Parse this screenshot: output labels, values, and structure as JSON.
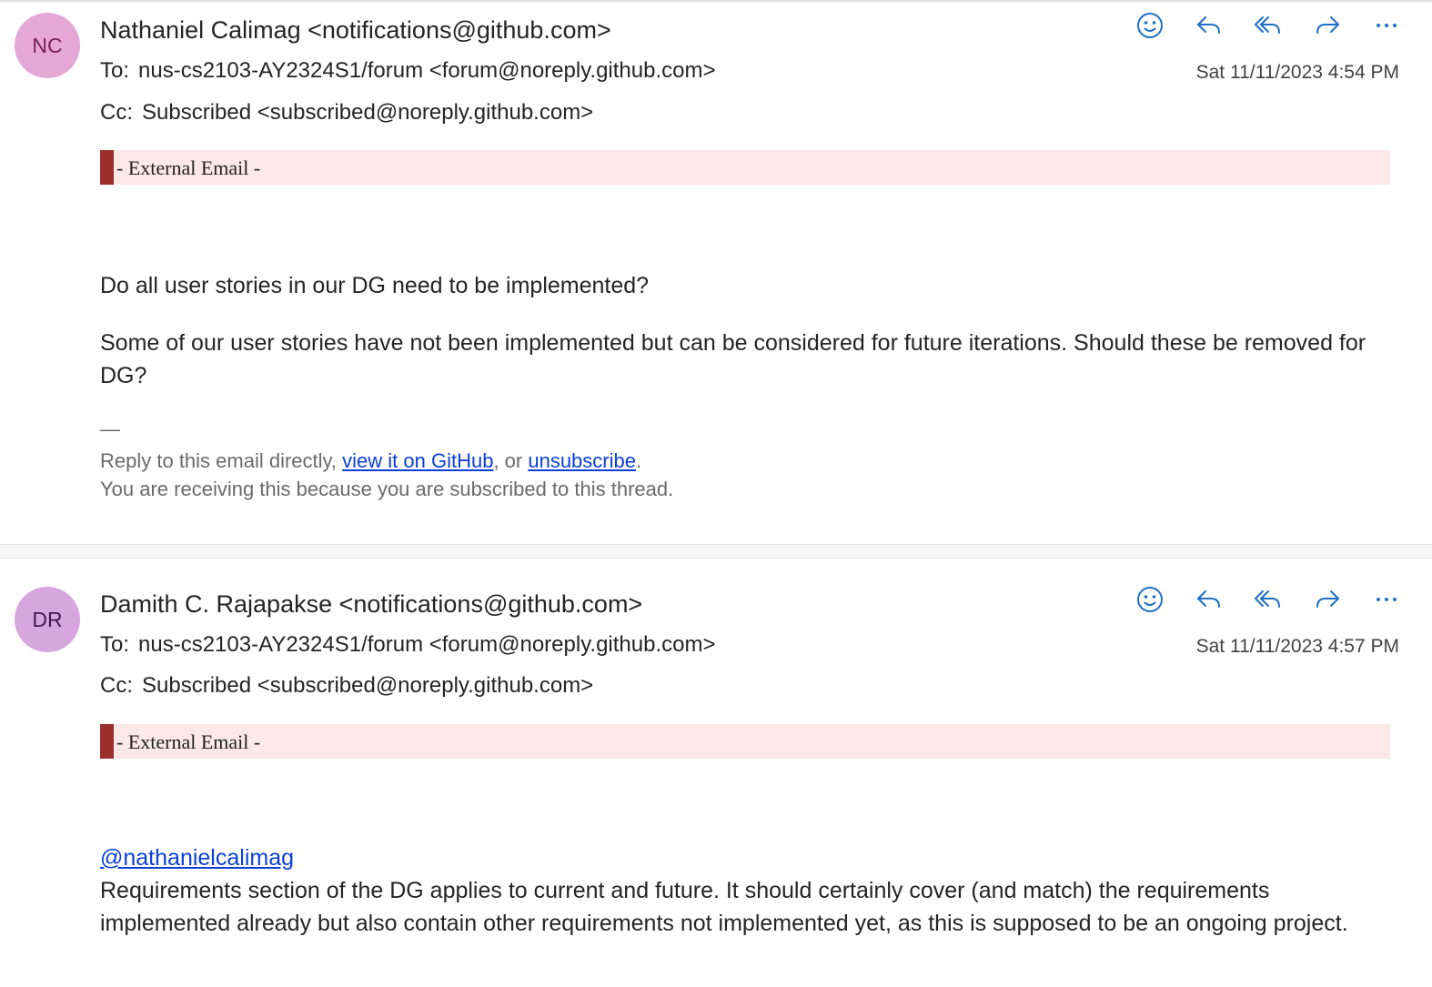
{
  "colors": {
    "accent": "#1f6fc4",
    "banner_bg": "#fce8e8",
    "banner_bar": "#9b2f2c",
    "link": "#0b3fd6"
  },
  "actions": [
    "smiley-icon",
    "reply-icon",
    "reply-all-icon",
    "forward-icon",
    "more-icon"
  ],
  "messages": [
    {
      "initials": "NC",
      "avatar_bg": "#e5a8d6",
      "avatar_fg": "#7a1d5c",
      "from": "Nathaniel Calimag <notifications@github.com>",
      "to_label": "To:",
      "to": "nus-cs2103-AY2324S1/forum <forum@noreply.github.com>",
      "cc_label": "Cc:",
      "cc": "Subscribed <subscribed@noreply.github.com>",
      "date": "Sat 11/11/2023 4:54 PM",
      "banner": "- External Email -",
      "para1": "Do all user stories in our DG need to be implemented?",
      "para2": "Some of our user stories have not been implemented but can be considered for future iterations. Should these be removed for DG?",
      "separator": "—",
      "footer_prefix": "Reply to this email directly, ",
      "footer_link1": "view it on GitHub",
      "footer_mid": ", or ",
      "footer_link2": "unsubscribe",
      "footer_suffix": ".",
      "footer_line2": "You are receiving this because you are subscribed to this thread."
    },
    {
      "initials": "DR",
      "avatar_bg": "#d7a6de",
      "avatar_fg": "#4a1457",
      "from": "Damith C. Rajapakse <notifications@github.com>",
      "to_label": "To:",
      "to": "nus-cs2103-AY2324S1/forum <forum@noreply.github.com>",
      "cc_label": "Cc:",
      "cc": "Subscribed <subscribed@noreply.github.com>",
      "date": "Sat 11/11/2023 4:57 PM",
      "banner": "- External Email -",
      "mention": "@nathanielcalimag",
      "para1": "Requirements section of the DG applies to current and future. It should certainly cover (and match) the requirements implemented already but also contain other requirements not implemented yet, as this is supposed to be an ongoing project."
    }
  ]
}
